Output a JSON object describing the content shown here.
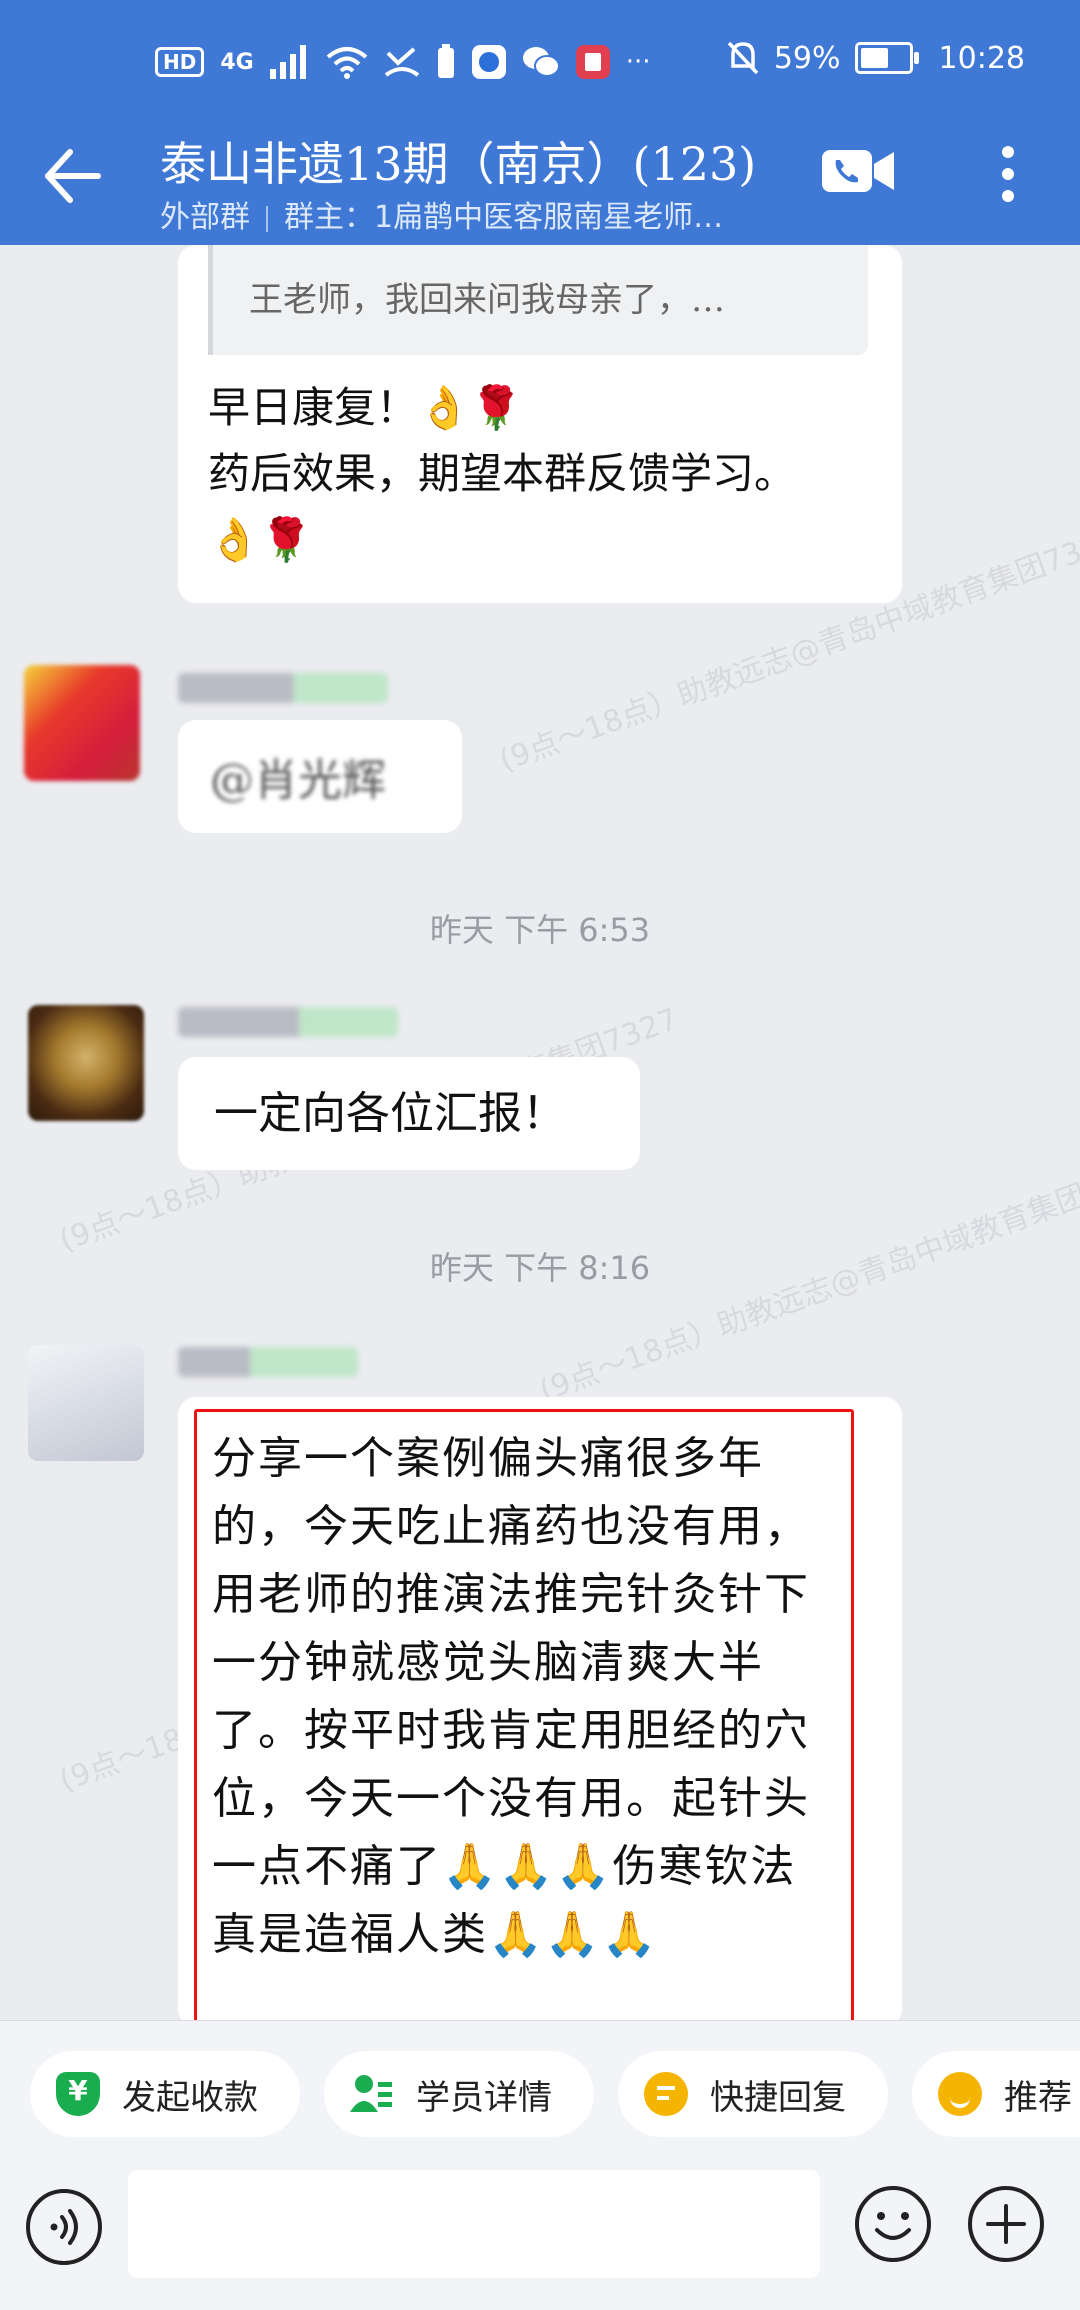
{
  "status_bar": {
    "hd": "HD",
    "network": "4G",
    "battery_percent": "59%",
    "time": "10:28",
    "more": "···"
  },
  "header": {
    "title": "泰山非遗13期（南京）(123)",
    "group_type": "外部群",
    "owner": "群主：1扁鹊中医客服南星老师…"
  },
  "messages": {
    "quote_text": "王老师，我回来问我母亲了，…",
    "reply_text": "早日康复！👌🌹\n药后效果，期望本群反馈学习。👌🌹",
    "msg2_text": "@肖光辉",
    "time1": "昨天  下午 6:53",
    "msg3_text": "一定向各位汇报！",
    "time2": "昨天  下午 8:16",
    "msg4_text": "分享一个案例偏头痛很多年的，今天吃止痛药也没有用，用老师的推演法推完针灸针下一分钟就感觉头脑清爽大半了。按平时我肯定用胆经的穴位，今天一个没有用。起针头一点不痛了🙏🙏🙏伤寒钦法真是造福人类🙏🙏🙏"
  },
  "watermark": "(9点～18点）助教远志@青岛中域教育集团7327",
  "quick_replies": [
    {
      "label": "发起收款",
      "icon": "yuan-icon",
      "color": "#1aad4f"
    },
    {
      "label": "学员详情",
      "icon": "student-icon",
      "color": "#1aad4f"
    },
    {
      "label": "快捷回复",
      "icon": "quick-reply-icon",
      "color": "#f4b400"
    },
    {
      "label": "推荐",
      "icon": "recommend-icon",
      "color": "#f4b400"
    }
  ],
  "input": {
    "placeholder": ""
  },
  "colors": {
    "header": "#3f79d5",
    "highlight": "#e11111",
    "chat_bg": "#ebecf0"
  }
}
